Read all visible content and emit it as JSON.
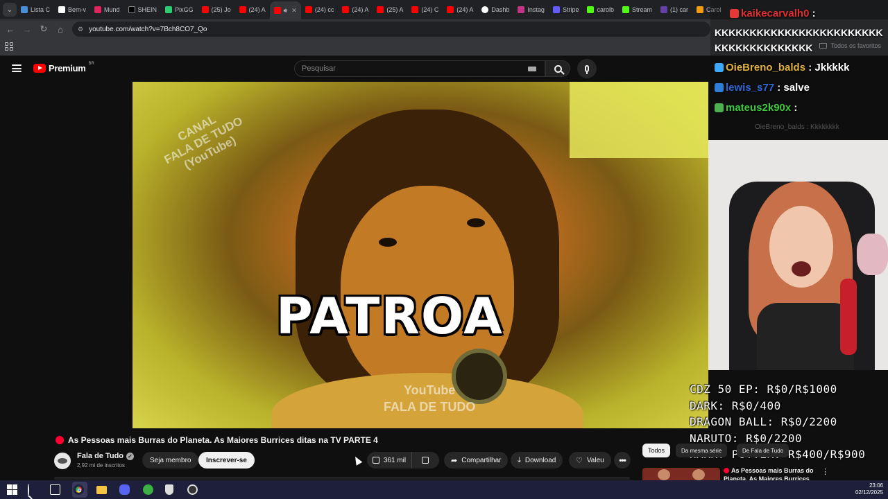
{
  "browser": {
    "tabs": [
      {
        "label": "Lista C",
        "color": "#4a90d9"
      },
      {
        "label": "Bem-v",
        "color": "#ffffff"
      },
      {
        "label": "Mund",
        "color": "#e0245e"
      },
      {
        "label": "SHEIN",
        "color": "#000000"
      },
      {
        "label": "PixGG",
        "color": "#2ecc71"
      },
      {
        "label": "(25) Jo",
        "color": "#ff0000"
      },
      {
        "label": "(24) A",
        "color": "#ff0000"
      },
      {
        "label": "",
        "color": "#ff0000",
        "active": true
      },
      {
        "label": "(24) cc",
        "color": "#ff0000"
      },
      {
        "label": "(24) A",
        "color": "#ff0000"
      },
      {
        "label": "(25) A",
        "color": "#ff0000"
      },
      {
        "label": "(24) C",
        "color": "#ff0000"
      },
      {
        "label": "(24) A",
        "color": "#ff0000"
      },
      {
        "label": "Dashb",
        "color": "#ffffff"
      },
      {
        "label": "Instag",
        "color": "#c13584"
      },
      {
        "label": "Stripe",
        "color": "#635bff"
      },
      {
        "label": "carolb",
        "color": "#53fc18"
      },
      {
        "label": "Stream",
        "color": "#53fc18"
      },
      {
        "label": "(1) car",
        "color": "#6441a5"
      },
      {
        "label": "Carol",
        "color": "#f39c12"
      }
    ],
    "url": "youtube.com/watch?v=7Bch8CO7_Qo",
    "favorites_label": "Todos os favoritos"
  },
  "youtube": {
    "brand": "Premium",
    "region": "BR",
    "search_placeholder": "Pesquisar"
  },
  "video": {
    "caption": "PATROA",
    "watermark_corner": [
      "CANAL",
      "FALA DE TUDO",
      "(YouTube)"
    ],
    "watermark_bottom": [
      "YouTube",
      "FALA DE TUDO"
    ],
    "title": "As Pessoas mais Burras do Planeta. As Maiores Burrices ditas na TV PARTE 4",
    "channel_name": "Fala de Tudo",
    "subscribers": "2,92 mi de inscritos",
    "member_label": "Seja membro",
    "subscribe_label": "Inscrever-se",
    "likes": "361 mil",
    "share_label": "Compartilhar",
    "download_label": "Download",
    "thanks_label": "Valeu",
    "more_glyph": "•••"
  },
  "chat": {
    "lines": [
      {
        "user": "kaikecarvalh0",
        "msg": ":",
        "badge_color": "#e53935"
      },
      {
        "user": "",
        "msg": "KKKKKKKKKKKKKKKKKKKKKKKKKKKKKKKKKKKKKK",
        "badge_color": ""
      },
      {
        "user": "OieBreno_balds",
        "msg": ": Jkkkkk",
        "badge_color": "#3da9fc"
      },
      {
        "user": "lewis_s77",
        "msg": ": salve",
        "badge_color": "#2e7dd7"
      },
      {
        "user": "mateus2k90x",
        "msg": ":",
        "badge_color": "#4caf50"
      }
    ],
    "faded": "OieBreno_balds : Kkkkkkkk"
  },
  "stream_stats": [
    "CDZ 50 EP: R$0/R$1000",
    "DARK: R$0/400",
    "DRAGON BALL: R$0/2200",
    "NARUTO: R$0/2200",
    "HARRY POTTER: R$400/R$900"
  ],
  "sidebar": {
    "chips": [
      "Todos",
      "Da mesma série",
      "De Fala de Tudo"
    ],
    "related_title": "As Pessoas mais Burras do Planeta. As Maiores Burrices"
  },
  "taskbar": {
    "time": "23:06",
    "date": "02/12/2025"
  }
}
